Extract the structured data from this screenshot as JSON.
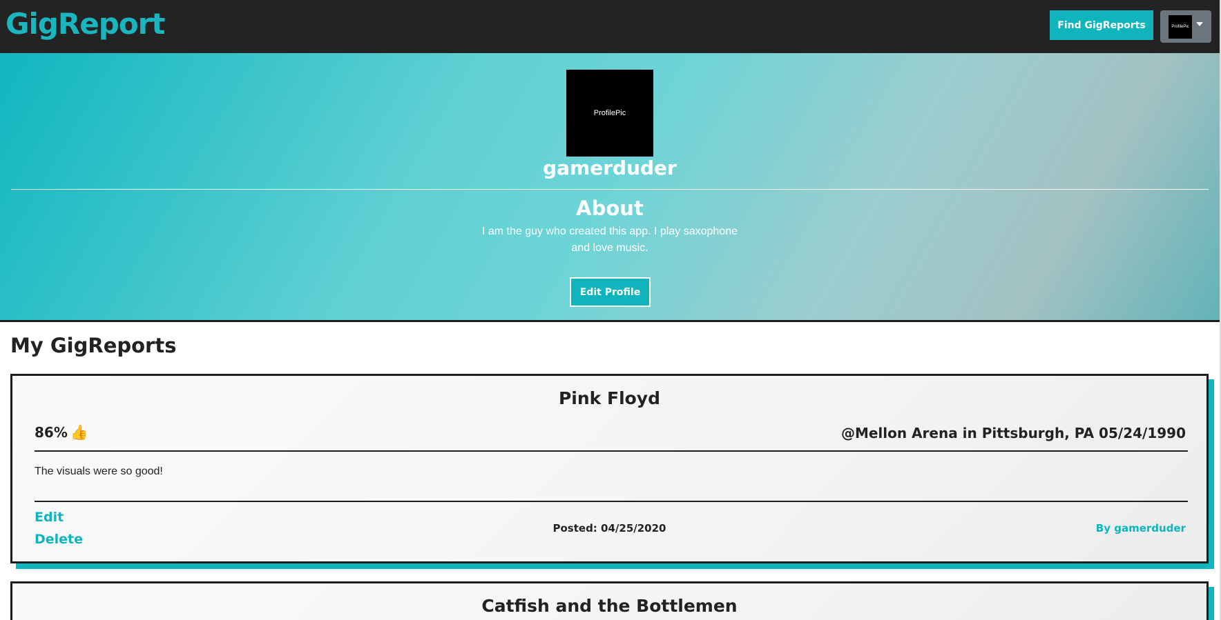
{
  "navbar": {
    "brand": "GigReport",
    "find_label": "Find GigReports",
    "avatar_text": "ProfilePic"
  },
  "profile": {
    "pic_text": "ProfilePic",
    "username": "gamerduder",
    "about_heading": "About",
    "about_text": "I am the guy who created this app. I play saxophone and love music.",
    "edit_label": "Edit Profile"
  },
  "section": {
    "title": "My GigReports"
  },
  "reports": [
    {
      "band": "Pink Floyd",
      "rating": "86%",
      "thumb": "👍",
      "venue": "@Mellon Arena in Pittsburgh, PA 05/24/1990",
      "review": "The visuals were so good!",
      "edit_label": "Edit",
      "delete_label": "Delete",
      "posted": "Posted: 04/25/2020",
      "by": "By gamerduder"
    },
    {
      "band": "Catfish and the Bottlemen"
    }
  ],
  "colors": {
    "accent": "#10b4bd",
    "navbar": "#232323",
    "card_border": "#1d1d1d"
  }
}
